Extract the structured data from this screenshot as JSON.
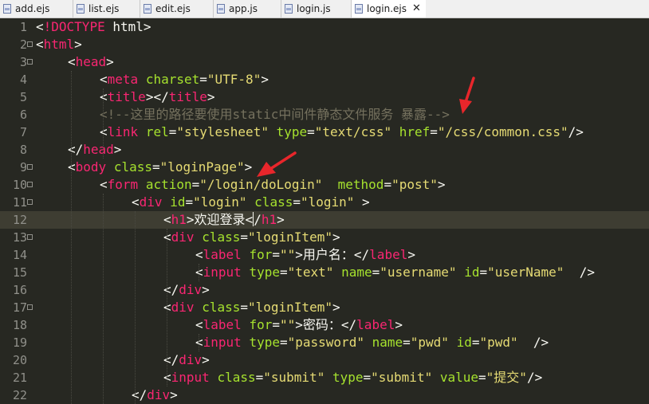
{
  "tabs": [
    {
      "label": "add.ejs",
      "icon": "ejs-file-icon",
      "active": false
    },
    {
      "label": "list.ejs",
      "icon": "ejs-file-icon",
      "active": false
    },
    {
      "label": "edit.ejs",
      "icon": "ejs-file-icon",
      "active": false
    },
    {
      "label": "app.js",
      "icon": "js-file-icon",
      "active": false
    },
    {
      "label": "login.js",
      "icon": "js-file-icon",
      "active": false
    },
    {
      "label": "login.ejs",
      "icon": "ejs-file-icon",
      "active": true
    }
  ],
  "close_glyph": "✕",
  "editor": {
    "current_line": 12,
    "lines": [
      {
        "n": "1",
        "fold": false,
        "indent": 0,
        "tokens": [
          [
            "p",
            "<"
          ],
          [
            "t",
            "!DOCTYPE"
          ],
          [
            "p",
            " html>"
          ]
        ]
      },
      {
        "n": "2",
        "fold": true,
        "indent": 0,
        "tokens": [
          [
            "p",
            "<"
          ],
          [
            "t",
            "html"
          ],
          [
            "p",
            ">"
          ]
        ]
      },
      {
        "n": "3",
        "fold": true,
        "indent": 1,
        "tokens": [
          [
            "p",
            "<"
          ],
          [
            "t",
            "head"
          ],
          [
            "p",
            ">"
          ]
        ]
      },
      {
        "n": "4",
        "fold": false,
        "indent": 2,
        "tokens": [
          [
            "p",
            "<"
          ],
          [
            "t",
            "meta"
          ],
          [
            "p",
            " "
          ],
          [
            "a",
            "charset"
          ],
          [
            "p",
            "="
          ],
          [
            "s",
            "\"UTF-8\""
          ],
          [
            "p",
            ">"
          ]
        ]
      },
      {
        "n": "5",
        "fold": false,
        "indent": 2,
        "tokens": [
          [
            "p",
            "<"
          ],
          [
            "t",
            "title"
          ],
          [
            "p",
            "></"
          ],
          [
            "t",
            "title"
          ],
          [
            "p",
            ">"
          ]
        ]
      },
      {
        "n": "6",
        "fold": false,
        "indent": 2,
        "tokens": [
          [
            "c",
            "<!--这里的路径要使用static中间件静态文件服务 暴露-->"
          ]
        ]
      },
      {
        "n": "7",
        "fold": false,
        "indent": 2,
        "tokens": [
          [
            "p",
            "<"
          ],
          [
            "t",
            "link"
          ],
          [
            "p",
            " "
          ],
          [
            "a",
            "rel"
          ],
          [
            "p",
            "="
          ],
          [
            "s",
            "\"stylesheet\""
          ],
          [
            "p",
            " "
          ],
          [
            "a",
            "type"
          ],
          [
            "p",
            "="
          ],
          [
            "s",
            "\"text/css\""
          ],
          [
            "p",
            " "
          ],
          [
            "a",
            "href"
          ],
          [
            "p",
            "="
          ],
          [
            "s",
            "\"/css/common.css\""
          ],
          [
            "p",
            "/>"
          ]
        ]
      },
      {
        "n": "8",
        "fold": false,
        "indent": 1,
        "tokens": [
          [
            "p",
            "</"
          ],
          [
            "t",
            "head"
          ],
          [
            "p",
            ">"
          ]
        ]
      },
      {
        "n": "9",
        "fold": true,
        "indent": 1,
        "tokens": [
          [
            "p",
            "<"
          ],
          [
            "t",
            "body"
          ],
          [
            "p",
            " "
          ],
          [
            "a",
            "class"
          ],
          [
            "p",
            "="
          ],
          [
            "s",
            "\"loginPage\""
          ],
          [
            "p",
            ">"
          ]
        ]
      },
      {
        "n": "10",
        "fold": true,
        "indent": 2,
        "tokens": [
          [
            "p",
            "<"
          ],
          [
            "t",
            "form"
          ],
          [
            "p",
            " "
          ],
          [
            "a",
            "action"
          ],
          [
            "p",
            "="
          ],
          [
            "s",
            "\"/login/doLogin\""
          ],
          [
            "p",
            "  "
          ],
          [
            "a",
            "method"
          ],
          [
            "p",
            "="
          ],
          [
            "s",
            "\"post\""
          ],
          [
            "p",
            ">"
          ]
        ]
      },
      {
        "n": "11",
        "fold": true,
        "indent": 3,
        "tokens": [
          [
            "p",
            "<"
          ],
          [
            "t",
            "div"
          ],
          [
            "p",
            " "
          ],
          [
            "a",
            "id"
          ],
          [
            "p",
            "="
          ],
          [
            "s",
            "\"login\""
          ],
          [
            "p",
            " "
          ],
          [
            "a",
            "class"
          ],
          [
            "p",
            "="
          ],
          [
            "s",
            "\"login\""
          ],
          [
            "p",
            " >"
          ]
        ]
      },
      {
        "n": "12",
        "fold": false,
        "indent": 4,
        "tokens": [
          [
            "p",
            "<"
          ],
          [
            "t",
            "h1"
          ],
          [
            "p",
            ">欢迎登录<"
          ],
          [
            "k",
            ""
          ],
          [
            "p",
            "/"
          ],
          [
            "t",
            "h1"
          ],
          [
            "p",
            ">"
          ]
        ]
      },
      {
        "n": "13",
        "fold": true,
        "indent": 4,
        "tokens": [
          [
            "p",
            "<"
          ],
          [
            "t",
            "div"
          ],
          [
            "p",
            " "
          ],
          [
            "a",
            "class"
          ],
          [
            "p",
            "="
          ],
          [
            "s",
            "\"loginItem\""
          ],
          [
            "p",
            ">"
          ]
        ]
      },
      {
        "n": "14",
        "fold": false,
        "indent": 5,
        "tokens": [
          [
            "p",
            "<"
          ],
          [
            "t",
            "label"
          ],
          [
            "p",
            " "
          ],
          [
            "a",
            "for"
          ],
          [
            "p",
            "="
          ],
          [
            "s",
            "\"\""
          ],
          [
            "p",
            ">用户名：</"
          ],
          [
            "t",
            "label"
          ],
          [
            "p",
            ">"
          ]
        ]
      },
      {
        "n": "15",
        "fold": false,
        "indent": 5,
        "tokens": [
          [
            "p",
            "<"
          ],
          [
            "t",
            "input"
          ],
          [
            "p",
            " "
          ],
          [
            "a",
            "type"
          ],
          [
            "p",
            "="
          ],
          [
            "s",
            "\"text\""
          ],
          [
            "p",
            " "
          ],
          [
            "a",
            "name"
          ],
          [
            "p",
            "="
          ],
          [
            "s",
            "\"username\""
          ],
          [
            "p",
            " "
          ],
          [
            "a",
            "id"
          ],
          [
            "p",
            "="
          ],
          [
            "s",
            "\"userName\""
          ],
          [
            "p",
            "  />"
          ]
        ]
      },
      {
        "n": "16",
        "fold": false,
        "indent": 4,
        "tokens": [
          [
            "p",
            "</"
          ],
          [
            "t",
            "div"
          ],
          [
            "p",
            ">"
          ]
        ]
      },
      {
        "n": "17",
        "fold": true,
        "indent": 4,
        "tokens": [
          [
            "p",
            "<"
          ],
          [
            "t",
            "div"
          ],
          [
            "p",
            " "
          ],
          [
            "a",
            "class"
          ],
          [
            "p",
            "="
          ],
          [
            "s",
            "\"loginItem\""
          ],
          [
            "p",
            ">"
          ]
        ]
      },
      {
        "n": "18",
        "fold": false,
        "indent": 5,
        "tokens": [
          [
            "p",
            "<"
          ],
          [
            "t",
            "label"
          ],
          [
            "p",
            " "
          ],
          [
            "a",
            "for"
          ],
          [
            "p",
            "="
          ],
          [
            "s",
            "\"\""
          ],
          [
            "p",
            ">密码：</"
          ],
          [
            "t",
            "label"
          ],
          [
            "p",
            ">"
          ]
        ]
      },
      {
        "n": "19",
        "fold": false,
        "indent": 5,
        "tokens": [
          [
            "p",
            "<"
          ],
          [
            "t",
            "input"
          ],
          [
            "p",
            " "
          ],
          [
            "a",
            "type"
          ],
          [
            "p",
            "="
          ],
          [
            "s",
            "\"password\""
          ],
          [
            "p",
            " "
          ],
          [
            "a",
            "name"
          ],
          [
            "p",
            "="
          ],
          [
            "s",
            "\"pwd\""
          ],
          [
            "p",
            " "
          ],
          [
            "a",
            "id"
          ],
          [
            "p",
            "="
          ],
          [
            "s",
            "\"pwd\""
          ],
          [
            "p",
            "  />"
          ]
        ]
      },
      {
        "n": "20",
        "fold": false,
        "indent": 4,
        "tokens": [
          [
            "p",
            "</"
          ],
          [
            "t",
            "div"
          ],
          [
            "p",
            ">"
          ]
        ]
      },
      {
        "n": "21",
        "fold": false,
        "indent": 4,
        "tokens": [
          [
            "p",
            "<"
          ],
          [
            "t",
            "input"
          ],
          [
            "p",
            " "
          ],
          [
            "a",
            "class"
          ],
          [
            "p",
            "="
          ],
          [
            "s",
            "\"submit\""
          ],
          [
            "p",
            " "
          ],
          [
            "a",
            "type"
          ],
          [
            "p",
            "="
          ],
          [
            "s",
            "\"submit\""
          ],
          [
            "p",
            " "
          ],
          [
            "a",
            "value"
          ],
          [
            "p",
            "="
          ],
          [
            "s",
            "\"提交\""
          ],
          [
            "p",
            "/>"
          ]
        ]
      },
      {
        "n": "22",
        "fold": false,
        "indent": 3,
        "tokens": [
          [
            "p",
            "</"
          ],
          [
            "t",
            "div"
          ],
          [
            "p",
            ">"
          ]
        ]
      }
    ]
  },
  "annotation_color": "#e8262b"
}
